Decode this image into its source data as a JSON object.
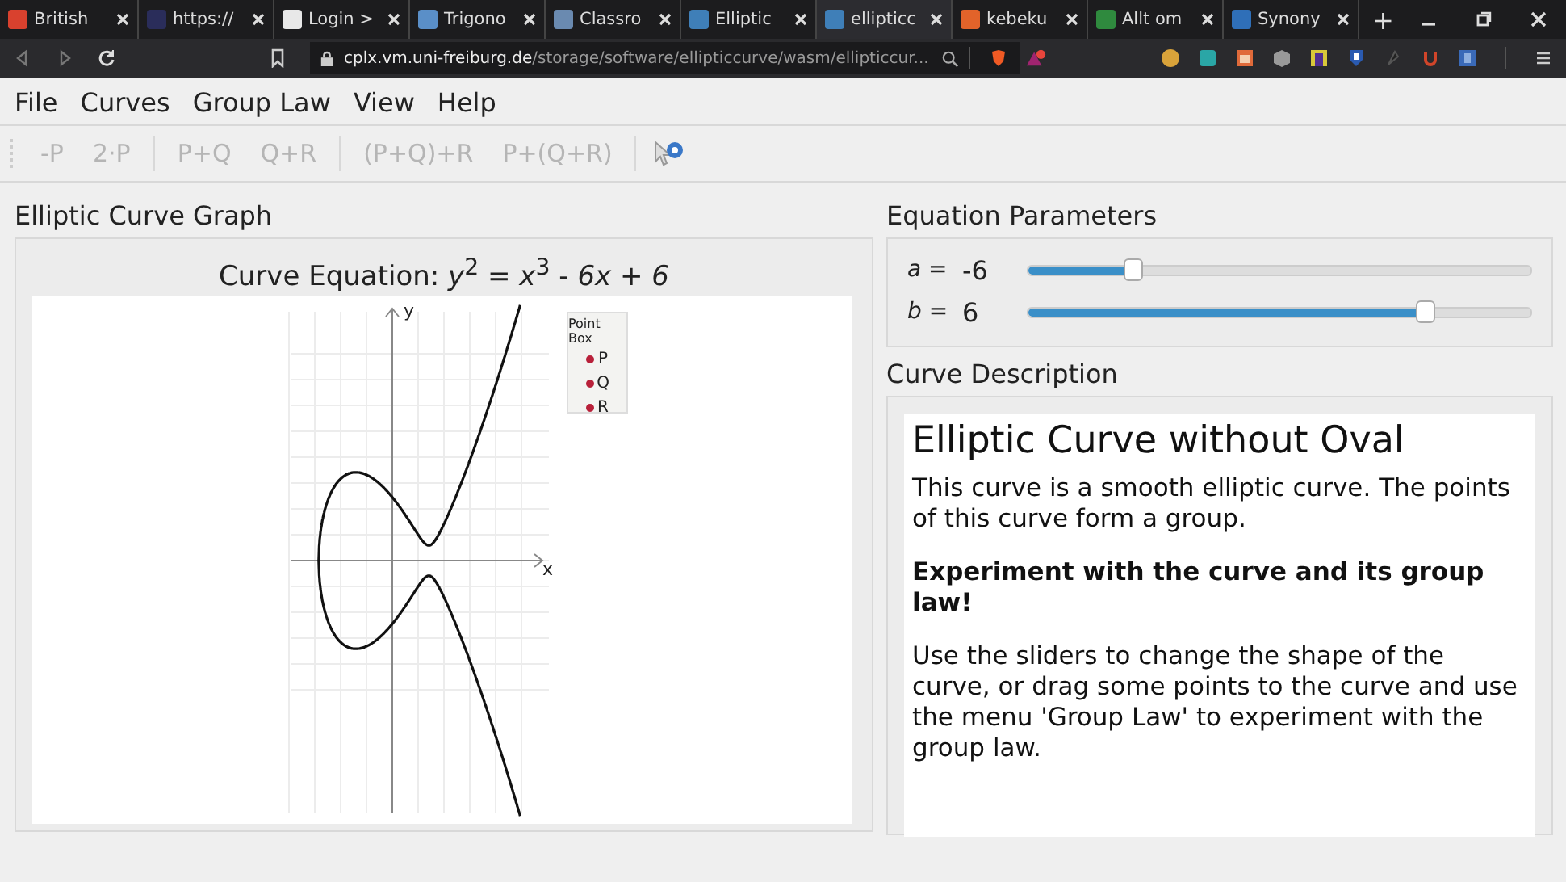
{
  "browser": {
    "tabs": [
      {
        "title": "British",
        "selected": false,
        "color": "#d9412e"
      },
      {
        "title": "https://",
        "selected": false,
        "color": "#2a2d5a"
      },
      {
        "title": "Login >",
        "selected": false,
        "color": "#e8e8e8"
      },
      {
        "title": "Trigono",
        "selected": false,
        "color": "#5a8fc8"
      },
      {
        "title": "Classro",
        "selected": false,
        "color": "#6a8ab0"
      },
      {
        "title": "Elliptic",
        "selected": false,
        "color": "#3f7fb8"
      },
      {
        "title": "ellipticc",
        "selected": true,
        "color": "#3f7fb8"
      },
      {
        "title": "kebeku",
        "selected": false,
        "color": "#e2632a"
      },
      {
        "title": "Allt om",
        "selected": false,
        "color": "#2f8a3e"
      },
      {
        "title": "Synony",
        "selected": false,
        "color": "#2f6fb8"
      }
    ],
    "new_tab": "+",
    "url_host": "cplx.vm.uni-freiburg.de",
    "url_path": "/storage/software/ellipticcurve/wasm/ellipticcur..."
  },
  "menu": [
    {
      "label": "File"
    },
    {
      "label": "Curves"
    },
    {
      "label": "Group Law"
    },
    {
      "label": "View"
    },
    {
      "label": "Help"
    }
  ],
  "toolbar": [
    [
      {
        "label": "-P",
        "disabled": true
      },
      {
        "label": "2·P",
        "disabled": true
      }
    ],
    [
      {
        "label": "P+Q",
        "disabled": true
      },
      {
        "label": "Q+R",
        "disabled": true
      }
    ],
    [
      {
        "label": "(P+Q)+R",
        "disabled": true
      },
      {
        "label": "P+(Q+R)",
        "disabled": true
      }
    ]
  ],
  "graph": {
    "title": "Elliptic Curve Graph",
    "equation": "Curve Equation: *y*$^{2}$ = *x*$^{3}$ - *6x* + *6*",
    "x_axis": "x",
    "y_axis": "y",
    "point_box": {
      "title": "Point Box",
      "points": [
        "P",
        "Q",
        "R"
      ]
    }
  },
  "parameters": {
    "title": "Equation Parameters",
    "sliders": [
      {
        "label": "a =",
        "reading": "-6",
        "level": 0.21
      },
      {
        "label": "b =",
        "reading": "6",
        "level": 0.79
      }
    ]
  },
  "description": {
    "title": "Curve Description",
    "heading": "Elliptic Curve without Oval",
    "paragraphs": [
      {
        "text": "This curve is a smooth elliptic curve. The points of this curve form a group.",
        "bold": false
      },
      {
        "text": "Experiment with the curve and its group law!",
        "bold": true
      },
      {
        "text": "Use the sliders to change the shape of the curve, or drag some points to the curve and use the menu 'Group Law' to experiment with the group law.",
        "bold": false
      }
    ]
  }
}
